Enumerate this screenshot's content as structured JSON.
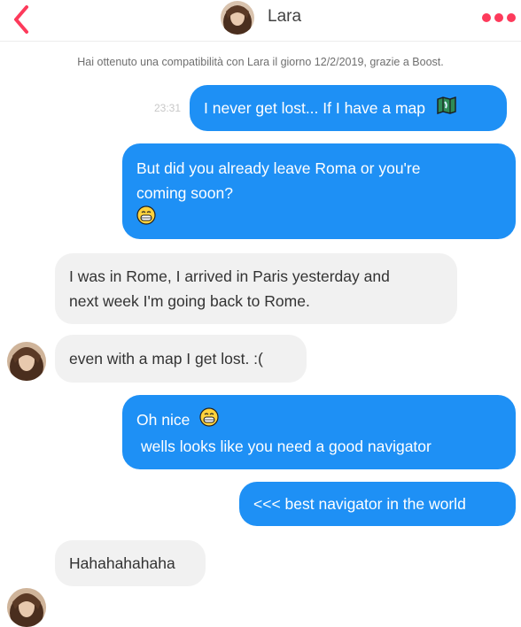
{
  "header": {
    "contact_name": "Lara",
    "back_icon": "chevron-left-icon",
    "more_icon": "more-dots-icon",
    "accent_color": "#fd3a5b"
  },
  "notice": "Hai ottenuto una compatibilità con Lara il giorno 12/2/2019, grazie a Boost.",
  "messages": [
    {
      "dir": "out",
      "time": "23:31",
      "text": "I never get lost... If I have a map",
      "emoji": "map-icon"
    },
    {
      "dir": "out",
      "line1": "But did you already leave Roma or you're",
      "line2": "coming soon?",
      "emoji": "grinning-face-icon"
    },
    {
      "dir": "in",
      "line1": "I was in Rome, I arrived in Paris yesterday and",
      "line2": "next week I'm going back to Rome."
    },
    {
      "dir": "in",
      "text": "even with a map I get lost. :("
    },
    {
      "dir": "out",
      "line1": "Oh nice",
      "line2": "wells looks like you need a good navigator",
      "emoji": "grinning-face-icon"
    },
    {
      "dir": "out",
      "text": "<<< best navigator in the world"
    },
    {
      "dir": "in",
      "text": "Hahahahahaha"
    }
  ],
  "colors": {
    "outgoing_bubble": "#1e90f5",
    "incoming_bubble": "#f1f1f1"
  }
}
